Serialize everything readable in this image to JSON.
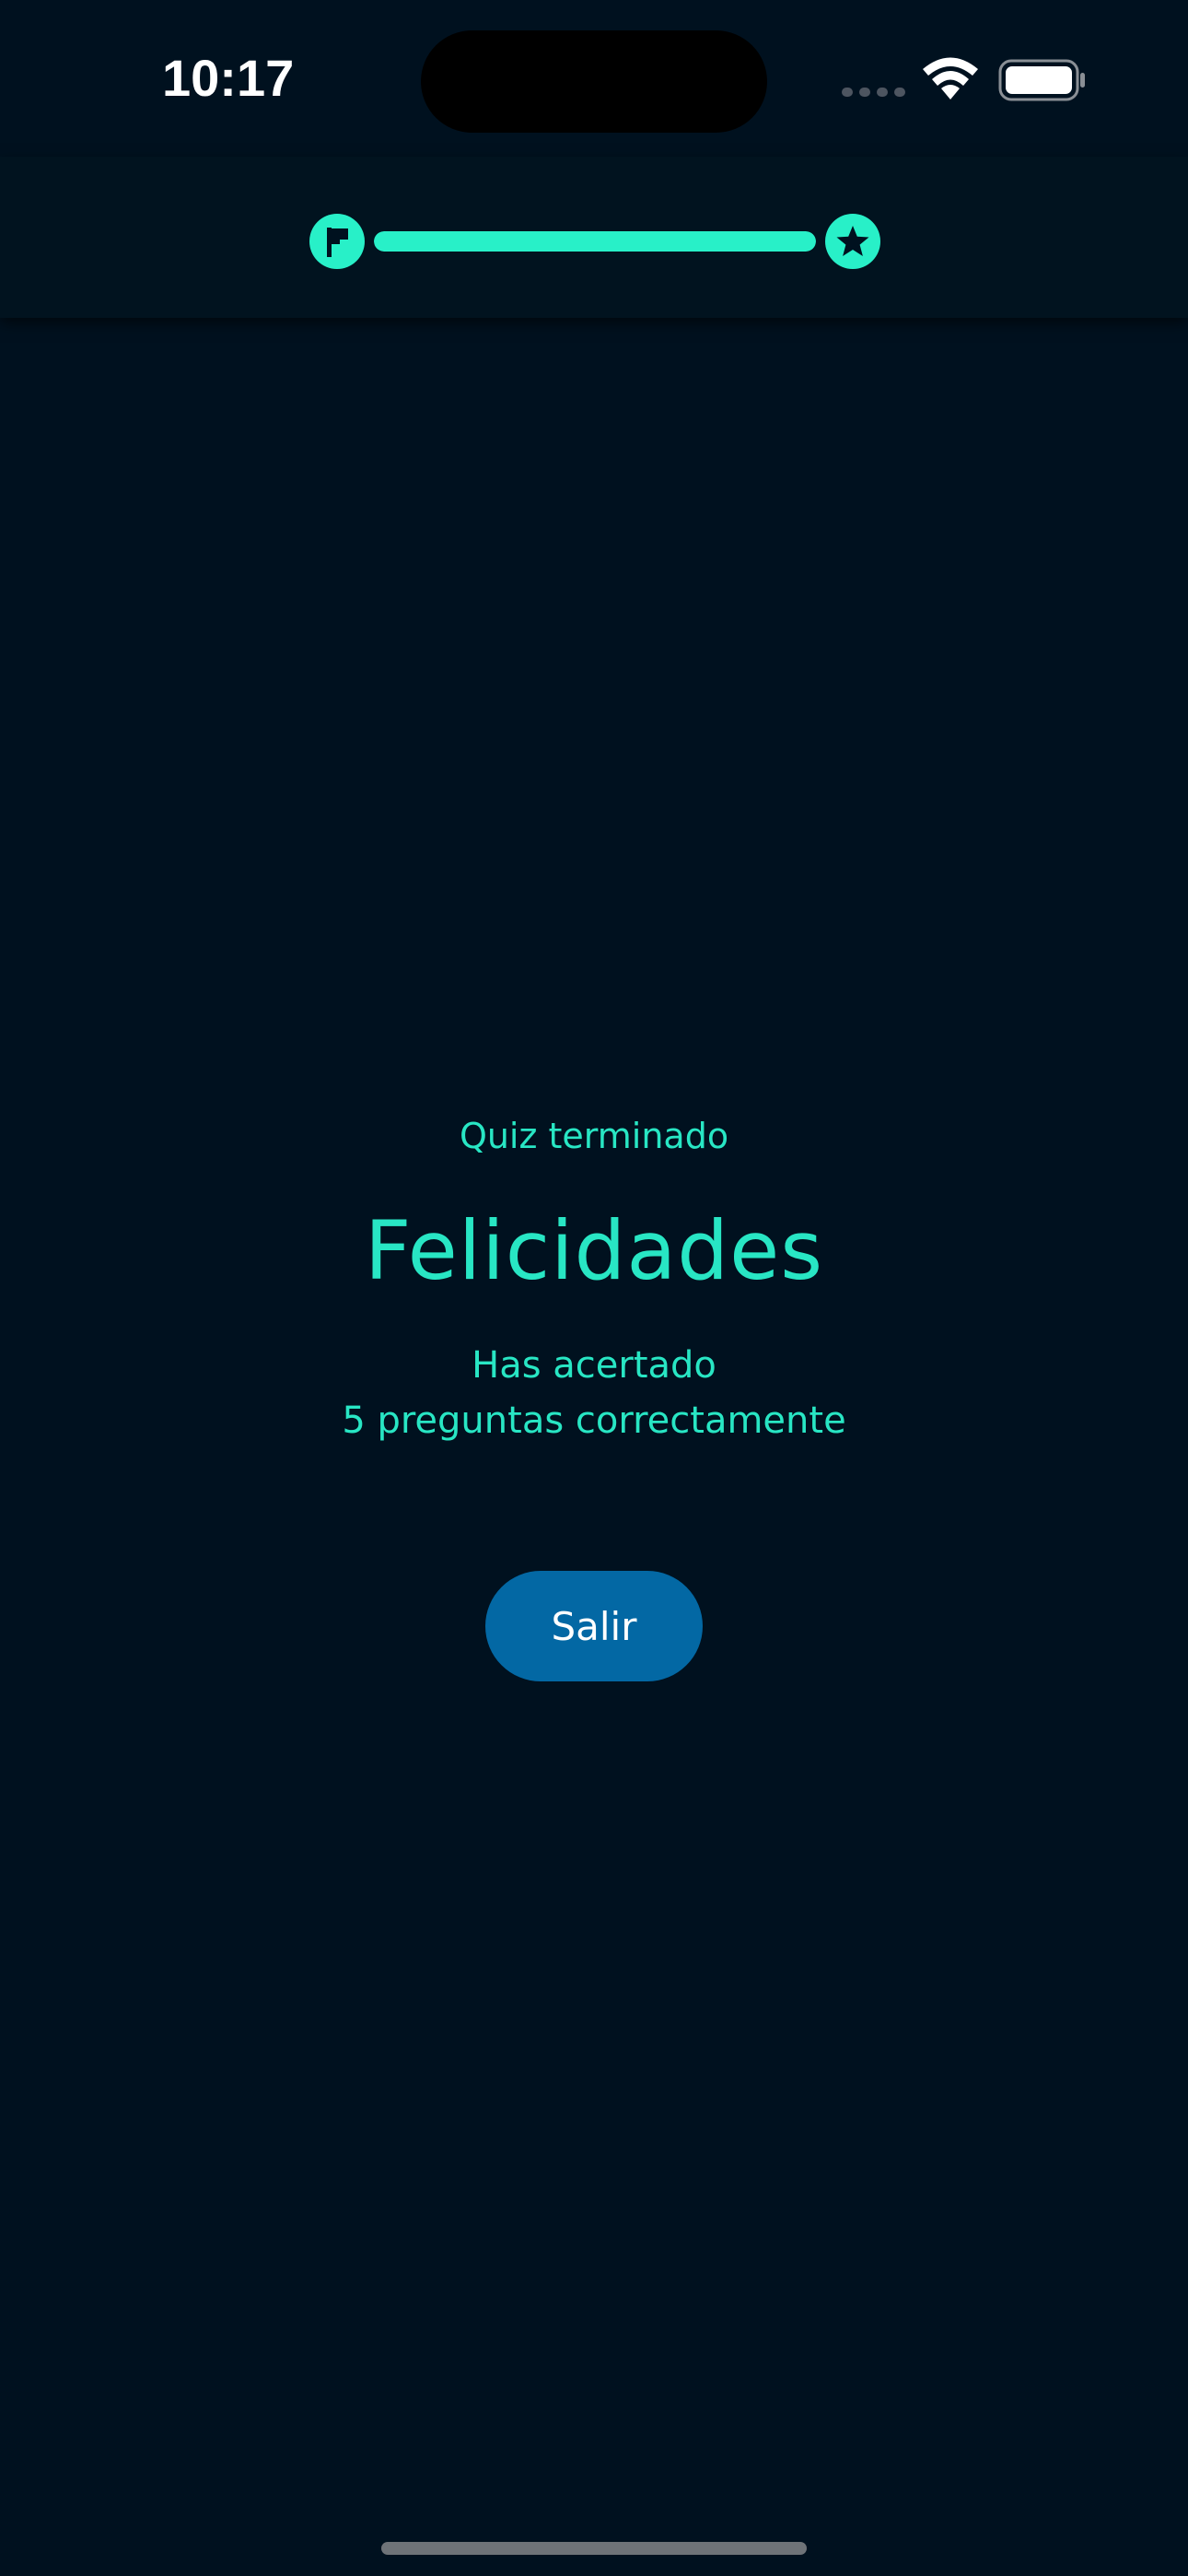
{
  "status_bar": {
    "time": "10:17",
    "icons": [
      "signal-icon",
      "wifi-icon",
      "battery-icon"
    ]
  },
  "progress": {
    "value": 1.0,
    "start_icon": "flag-icon",
    "end_icon": "star-icon"
  },
  "result": {
    "subtitle": "Quiz terminado",
    "title": "Felicidades",
    "line1": "Has acertado",
    "line2": "5 preguntas correctamente"
  },
  "actions": {
    "exit_label": "Salir"
  },
  "colors": {
    "background": "#00111f",
    "accent": "#28e6c4",
    "button": "#0368a4"
  }
}
